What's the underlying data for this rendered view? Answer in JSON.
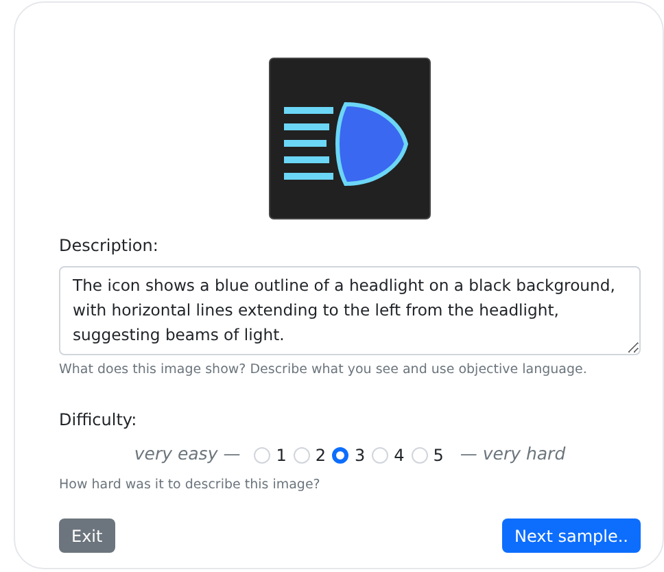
{
  "description": {
    "label": "Description:",
    "value": "The icon shows a blue outline of a headlight on a black background, with horizontal lines extending to the left from the headlight, suggesting beams of light.",
    "help": "What does this image show? Describe what you see and use objective language."
  },
  "difficulty": {
    "label": "Difficulty:",
    "low_label": "very easy —",
    "high_label": "— very hard",
    "help": "How hard was it to describe this image?",
    "options": [
      {
        "label": "1",
        "selected": false
      },
      {
        "label": "2",
        "selected": false
      },
      {
        "label": "3",
        "selected": true
      },
      {
        "label": "4",
        "selected": false
      },
      {
        "label": "5",
        "selected": false
      }
    ]
  },
  "buttons": [
    {
      "label": "Exit",
      "kind": "secondary"
    },
    {
      "label": "Next sample..",
      "kind": "primary"
    }
  ]
}
